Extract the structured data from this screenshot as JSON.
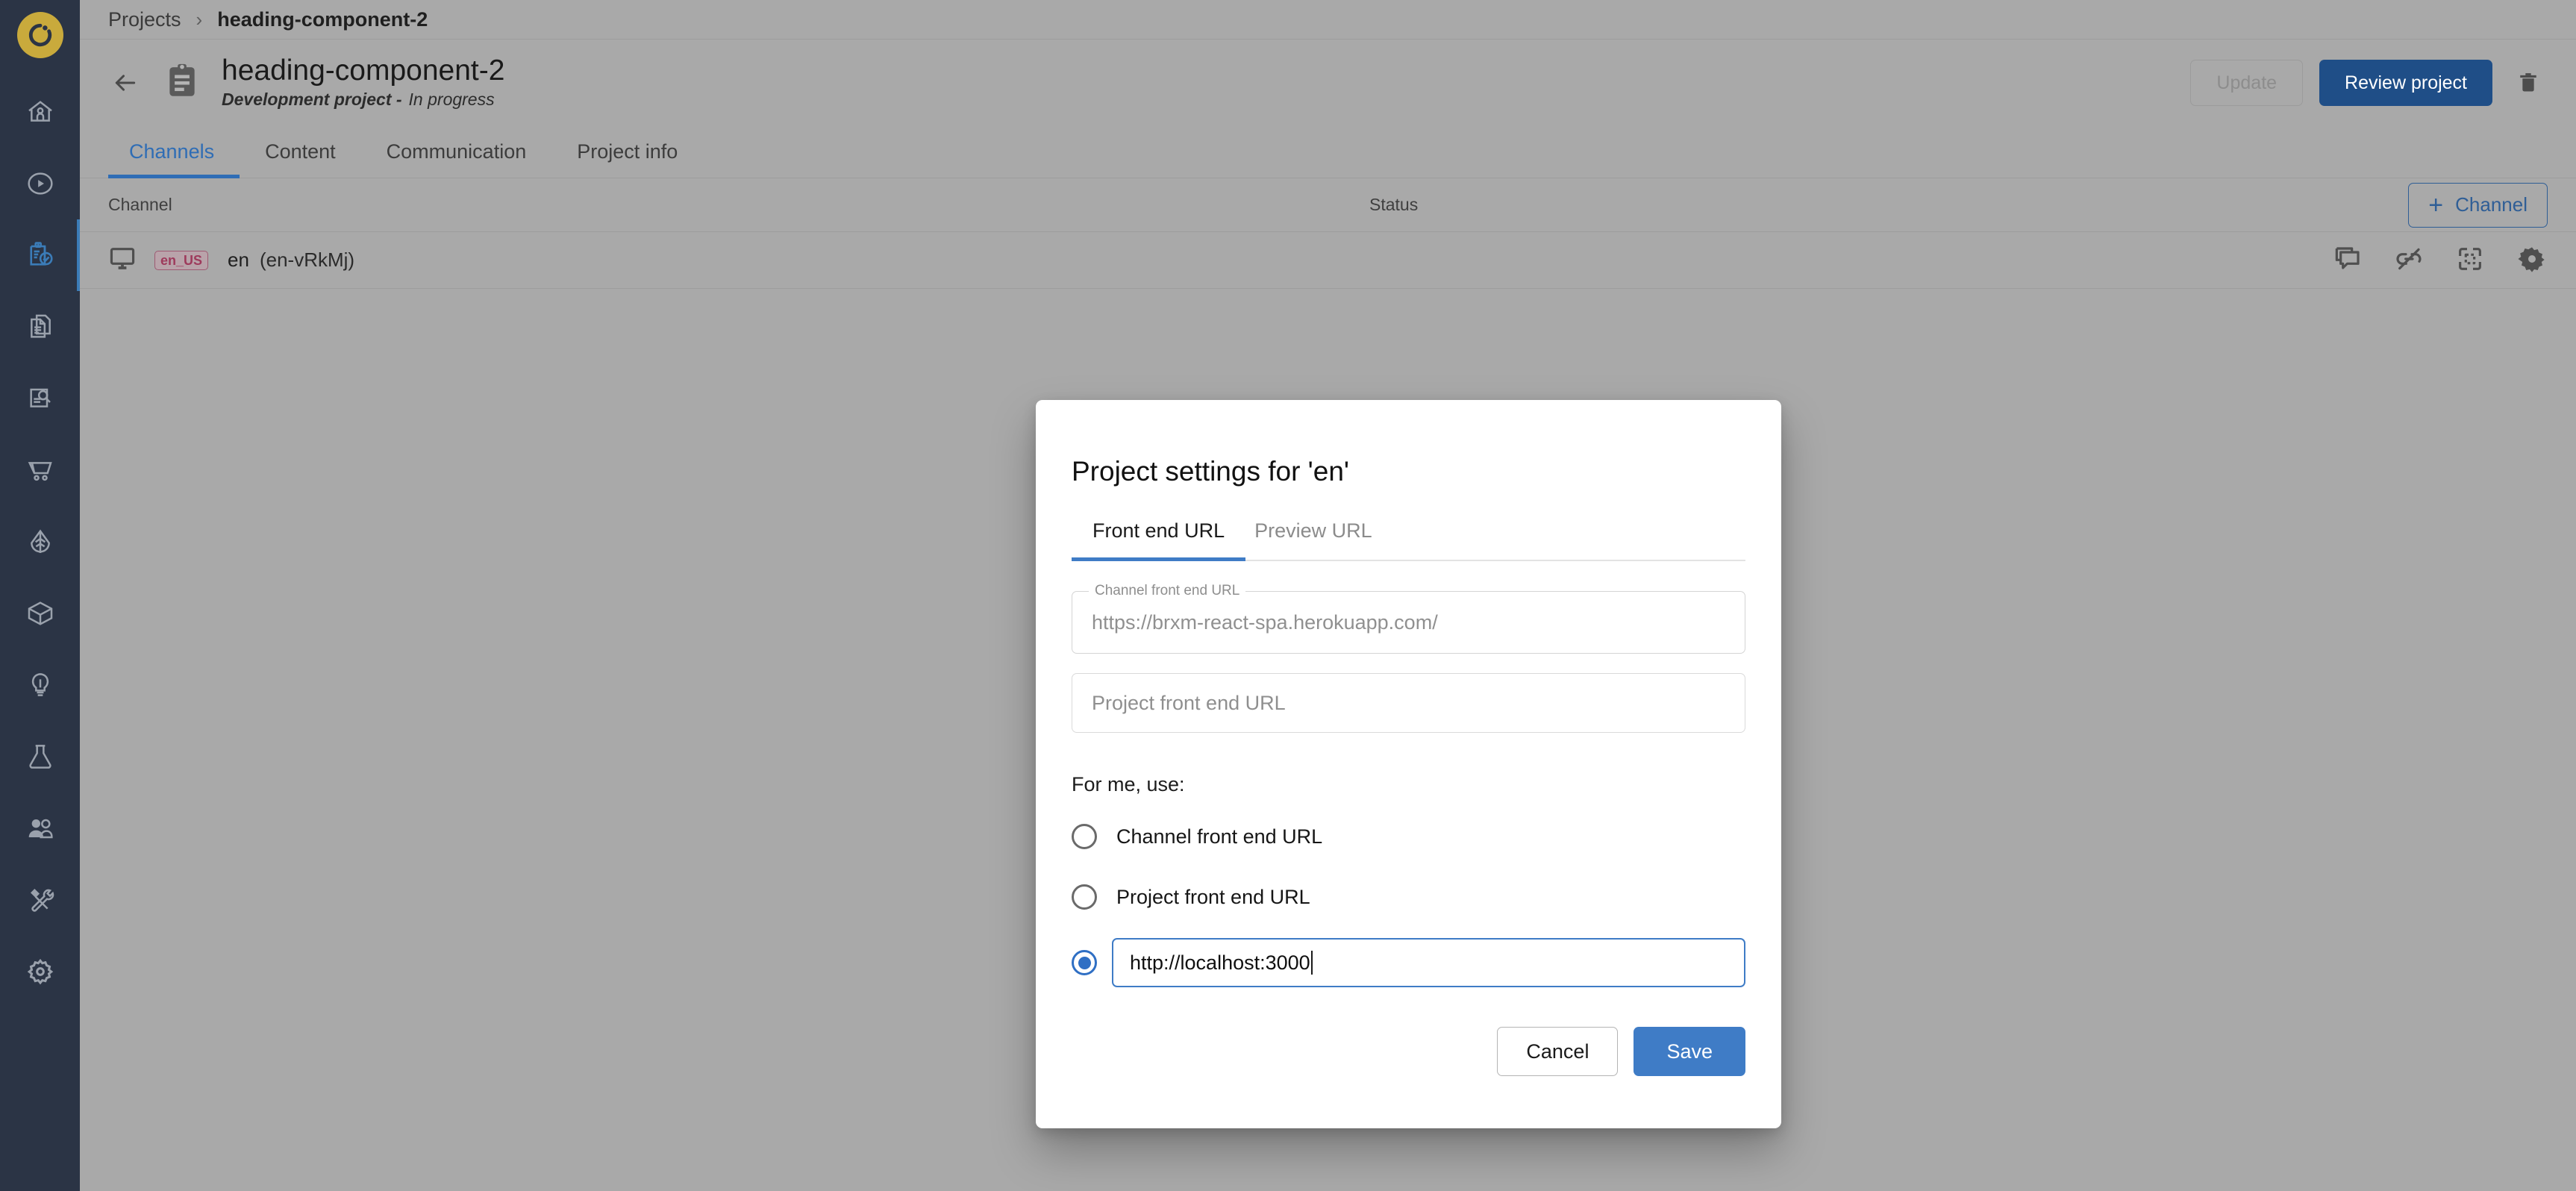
{
  "colors": {
    "rail_bg": "#2b3445",
    "logo_bg": "#c9aa3c",
    "accent_blue": "#3f7cc6",
    "tab_blue": "#2f6db5",
    "review_blue": "#1f4e87",
    "page_bg": "#a9a9a9",
    "chip_text": "#9e3a5c"
  },
  "rail": {
    "logo_icon": "brand-logo-icon",
    "items": [
      {
        "icon": "home-icon",
        "name": "home"
      },
      {
        "icon": "play-circle-icon",
        "name": "experience-manager"
      },
      {
        "icon": "clipboard-check-icon",
        "name": "projects",
        "active": true
      },
      {
        "icon": "documents-icon",
        "name": "content"
      },
      {
        "icon": "document-search-icon",
        "name": "document-search"
      },
      {
        "icon": "shopping-cart-icon",
        "name": "commerce"
      },
      {
        "icon": "leaf-icon",
        "name": "relevance"
      },
      {
        "icon": "box-icon",
        "name": "assets"
      },
      {
        "icon": "lightbulb-icon",
        "name": "insights"
      },
      {
        "icon": "flask-icon",
        "name": "experiments"
      },
      {
        "icon": "users-icon",
        "name": "audiences"
      },
      {
        "icon": "tools-icon",
        "name": "setup"
      },
      {
        "icon": "gear-icon",
        "name": "settings"
      }
    ]
  },
  "breadcrumb": {
    "root": "Projects",
    "separator": "›",
    "current": "heading-component-2"
  },
  "project_header": {
    "back_icon": "back-arrow-icon",
    "project_icon": "clipboard-icon",
    "title": "heading-component-2",
    "type": "Development project -",
    "state": "In progress",
    "update_label": "Update",
    "review_label": "Review project",
    "delete_icon": "trash-icon"
  },
  "tabs": [
    {
      "label": "Channels",
      "active": true
    },
    {
      "label": "Content",
      "active": false
    },
    {
      "label": "Communication",
      "active": false
    },
    {
      "label": "Project info",
      "active": false
    }
  ],
  "table": {
    "headers": {
      "channel": "Channel",
      "status": "Status"
    },
    "add_button": {
      "plus": "+",
      "label": "Channel"
    },
    "rows": [
      {
        "device_icon": "monitor-icon",
        "locale_chip": "en_US",
        "name": "en",
        "id": "(en-vRkMj)",
        "status": "",
        "actions": [
          {
            "icon": "comment-icon",
            "name": "comments"
          },
          {
            "icon": "link-off-icon",
            "name": "unlink-channel"
          },
          {
            "icon": "copy-frame-icon",
            "name": "copy-channel"
          },
          {
            "icon": "gear-icon",
            "name": "channel-settings"
          }
        ]
      }
    ]
  },
  "dialog": {
    "title": "Project settings for 'en'",
    "tabs": [
      {
        "label": "Front end URL",
        "active": true
      },
      {
        "label": "Preview URL",
        "active": false
      }
    ],
    "channel_url_field": {
      "legend": "Channel front end URL",
      "value": "https://brxm-react-spa.herokuapp.com/"
    },
    "project_url_field": {
      "placeholder": "Project front end URL",
      "value": ""
    },
    "for_me_label": "For me, use:",
    "radios": [
      {
        "label": "Channel front end URL",
        "checked": false,
        "type": "label"
      },
      {
        "label": "Project front end URL",
        "checked": false,
        "type": "label"
      },
      {
        "label": "",
        "checked": true,
        "type": "input",
        "value": "http://localhost:3000"
      }
    ],
    "cancel_label": "Cancel",
    "save_label": "Save"
  }
}
